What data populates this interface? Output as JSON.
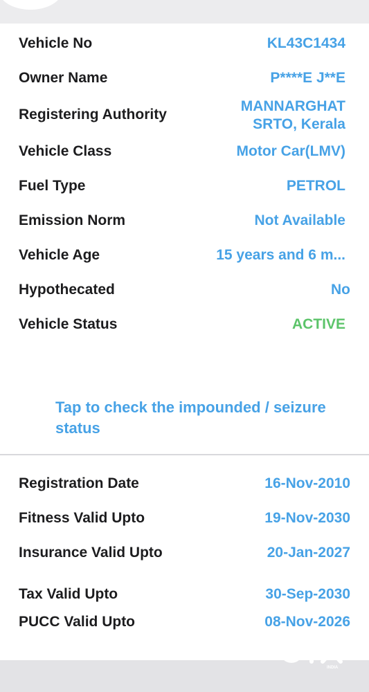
{
  "vehicle": [
    {
      "label": "Vehicle No",
      "value": "KL43C1434"
    },
    {
      "label": "Owner Name",
      "value": "P****E J**E"
    },
    {
      "label": "Registering Authority",
      "value": "MANNARGHAT SRTO, Kerala"
    },
    {
      "label": "Vehicle Class",
      "value": "Motor Car(LMV)"
    },
    {
      "label": "Fuel Type",
      "value": "PETROL"
    },
    {
      "label": "Emission Norm",
      "value": "Not Available"
    },
    {
      "label": "Vehicle Age",
      "value": "15 years and 6 m..."
    },
    {
      "label": "Hypothecated",
      "value": "No"
    },
    {
      "label": "Vehicle Status",
      "value": "ACTIVE"
    }
  ],
  "impound_link": "Tap to check the impounded / seizure status",
  "validity": [
    {
      "label": "Registration Date",
      "value": "16-Nov-2010"
    },
    {
      "label": "Fitness Valid Upto",
      "value": "19-Nov-2030"
    },
    {
      "label": "Insurance Valid Upto",
      "value": "20-Jan-2027"
    },
    {
      "label": "Tax Valid Upto",
      "value": "30-Sep-2030"
    },
    {
      "label": "PUCC Valid Upto",
      "value": "08-Nov-2026"
    }
  ],
  "colors": {
    "accent": "#47a2e6",
    "status_active": "#5cc46a",
    "text": "#1c1c1e"
  },
  "watermark": {
    "brand": "OLX",
    "sub": "INDIA"
  }
}
